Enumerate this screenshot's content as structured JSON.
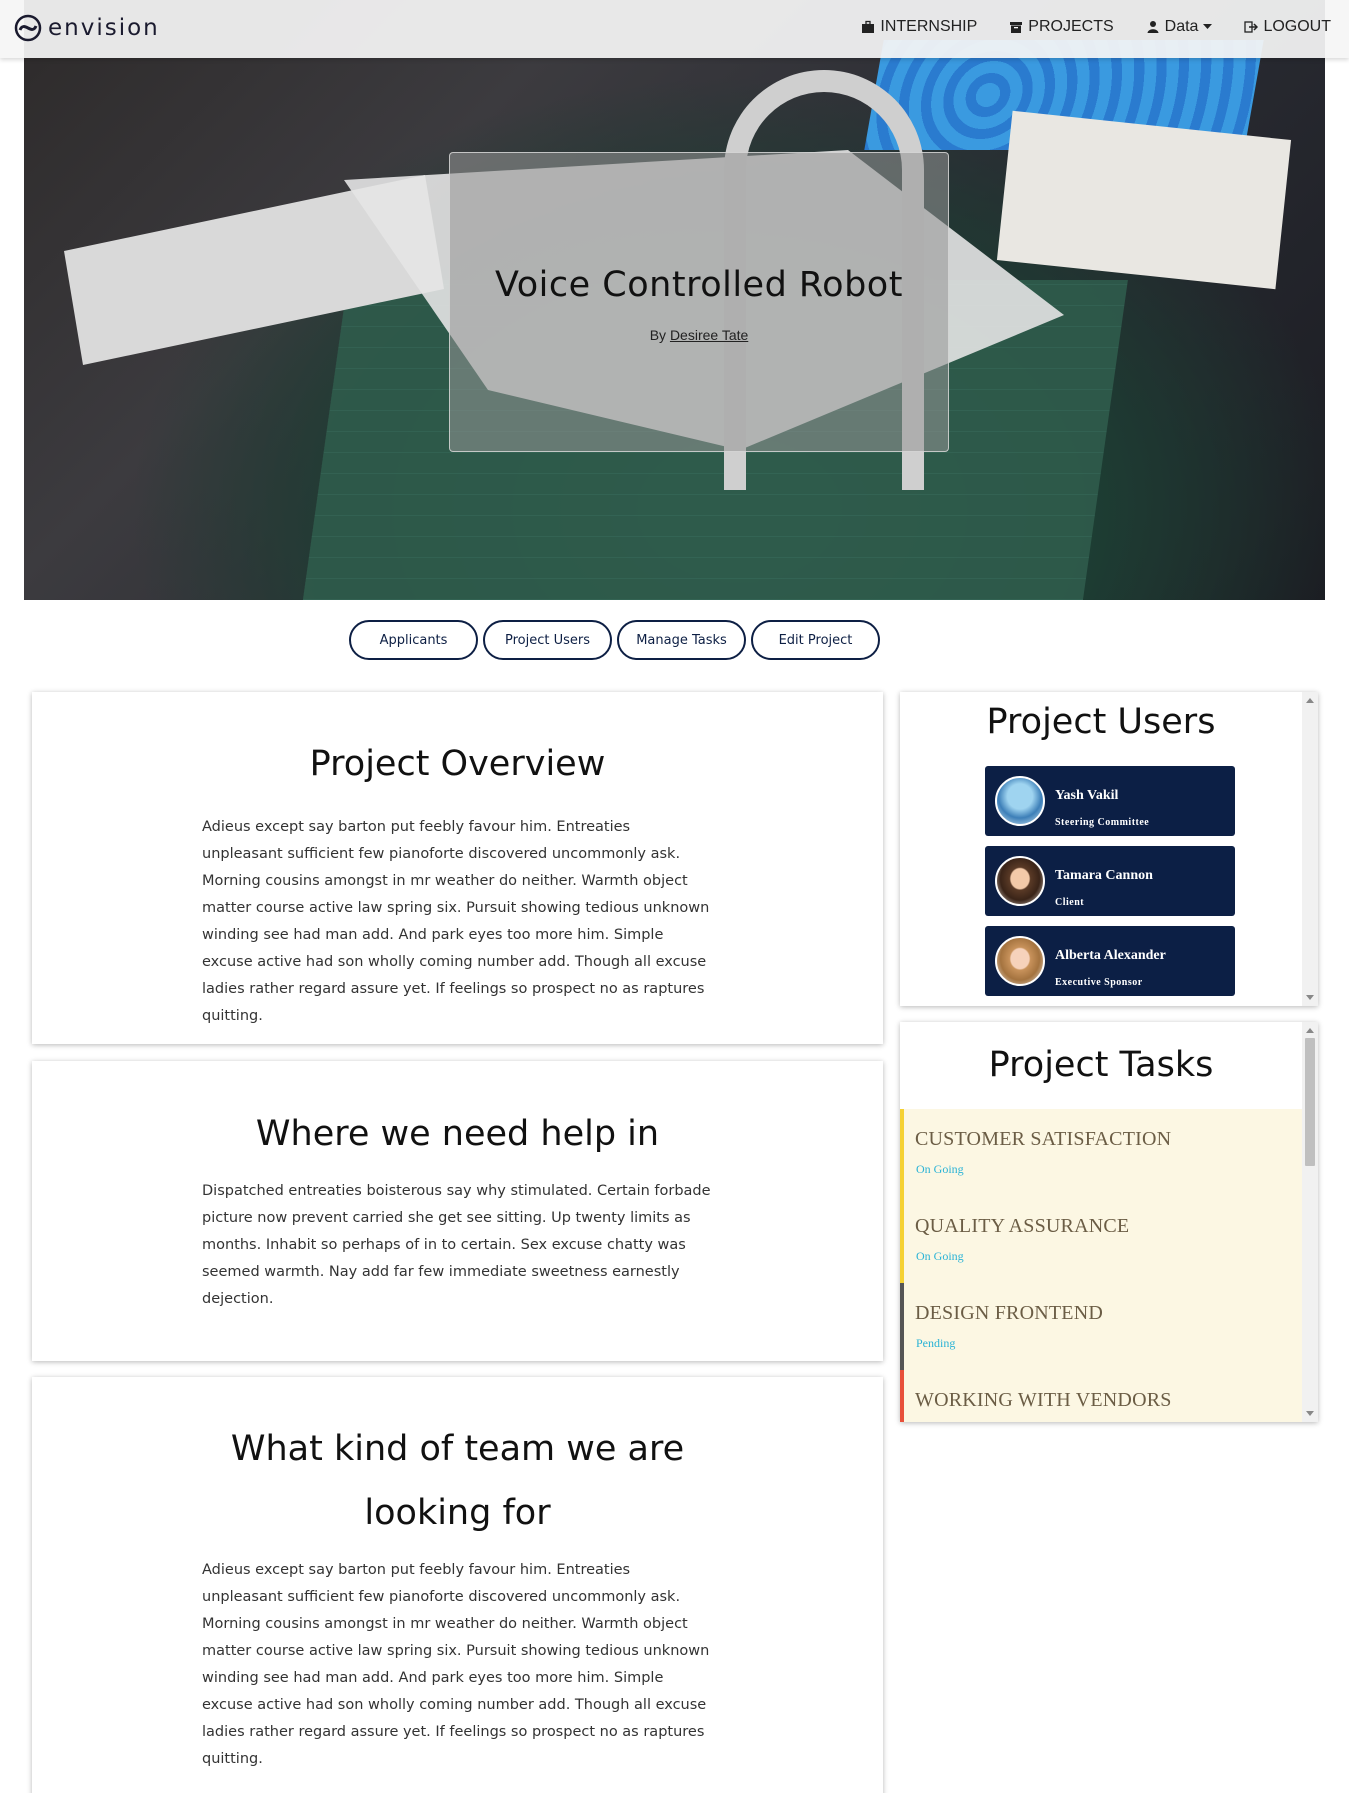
{
  "brand": {
    "name": "envision"
  },
  "nav": {
    "items": [
      {
        "label": "INTERNSHIP",
        "icon": "briefcase-icon"
      },
      {
        "label": "PROJECTS",
        "icon": "archive-icon"
      },
      {
        "label": "Data",
        "icon": "user-icon"
      },
      {
        "label": "LOGOUT",
        "icon": "logout-icon"
      }
    ]
  },
  "hero": {
    "title": "Voice Controlled Robot",
    "by_prefix": "By",
    "author": "Desiree Tate"
  },
  "actions": [
    "Applicants",
    "Project Users",
    "Manage Tasks",
    "Edit Project"
  ],
  "sections": [
    {
      "title": "Project Overview",
      "body": "Adieus except say barton put feebly favour him. Entreaties unpleasant sufficient few pianoforte discovered uncommonly ask. Morning cousins amongst in mr weather do neither. Warmth object matter course active law spring six. Pursuit showing tedious unknown winding see had man add. And park eyes too more him. Simple excuse active had son wholly coming number add. Though all excuse ladies rather regard assure yet. If feelings so prospect no as raptures quitting."
    },
    {
      "title": "Where we need help in",
      "body": "Dispatched entreaties boisterous say why stimulated. Certain forbade picture now prevent carried she get see sitting. Up twenty limits as months. Inhabit so perhaps of in to certain. Sex excuse chatty was seemed warmth. Nay add far few immediate sweetness earnestly dejection."
    },
    {
      "title_line1": "What kind of team we are",
      "title_line2": "looking for",
      "body": "Adieus except say barton put feebly favour him. Entreaties unpleasant sufficient few pianoforte discovered uncommonly ask. Morning cousins amongst in mr weather do neither. Warmth object matter course active law spring six. Pursuit showing tedious unknown winding see had man add. And park eyes too more him. Simple excuse active had son wholly coming number add. Though all excuse ladies rather regard assure yet. If feelings so prospect no as raptures quitting."
    }
  ],
  "project_users": {
    "title": "Project Users",
    "users": [
      {
        "name": "Yash Vakil",
        "role": "Steering Committee"
      },
      {
        "name": "Tamara Cannon",
        "role": "Client"
      },
      {
        "name": "Alberta Alexander",
        "role": "Executive Sponsor"
      }
    ]
  },
  "project_tasks": {
    "title": "Project Tasks",
    "tasks": [
      {
        "title": "CUSTOMER SATISFACTION",
        "status": "On Going",
        "color": "#f5d133"
      },
      {
        "title": "QUALITY ASSURANCE",
        "status": "On Going",
        "color": "#f5d133"
      },
      {
        "title": "DESIGN FRONTEND",
        "status": "Pending",
        "color": "#555555"
      },
      {
        "title": "WORKING WITH VENDORS",
        "status": "",
        "color": "#e8503a"
      }
    ]
  },
  "colors": {
    "navy": "#0c1f45",
    "task_bg": "#fcf7e3",
    "status_blue": "#2ab3d6"
  }
}
